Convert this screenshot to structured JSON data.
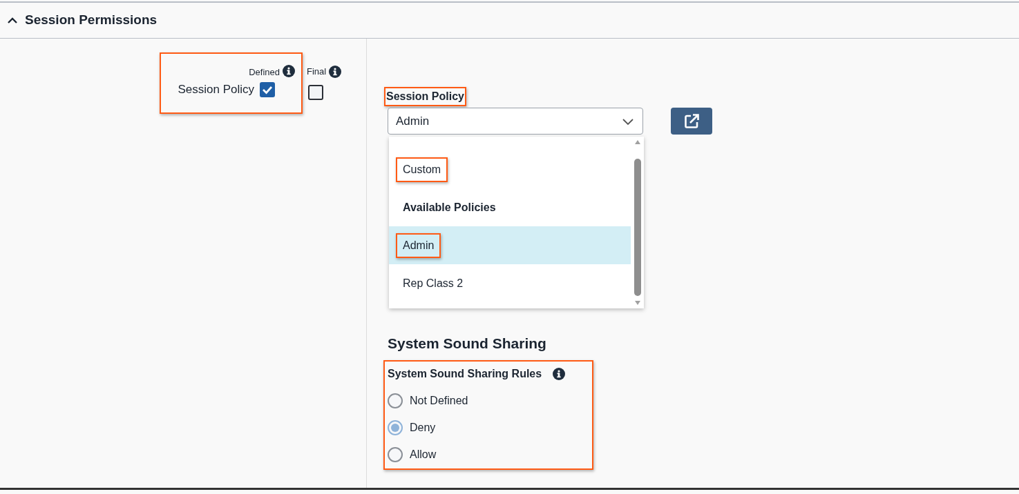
{
  "section": {
    "title": "Session Permissions",
    "expanded": true
  },
  "policy_flags": {
    "columns": [
      "Defined",
      "Final"
    ],
    "row": {
      "label": "Session Policy",
      "defined": true,
      "final": false,
      "highlighted": true
    }
  },
  "session_policy": {
    "label": "Session Policy",
    "label_highlighted": true,
    "value": "Admin",
    "open": true,
    "options": [
      {
        "kind": "option",
        "label": "Custom",
        "selected": false,
        "highlighted": true
      },
      {
        "kind": "group",
        "label": "Available Policies"
      },
      {
        "kind": "option",
        "label": "Admin",
        "selected": true,
        "highlighted": true
      },
      {
        "kind": "option",
        "label": "Rep Class 2",
        "selected": false,
        "highlighted": false
      }
    ]
  },
  "system_sound_sharing": {
    "heading": "System Sound Sharing",
    "rules": {
      "label": "System Sound Sharing Rules",
      "highlighted": true,
      "options": [
        {
          "label": "Not Defined",
          "selected": false
        },
        {
          "label": "Deny",
          "selected": true
        },
        {
          "label": "Allow",
          "selected": false
        }
      ]
    }
  }
}
